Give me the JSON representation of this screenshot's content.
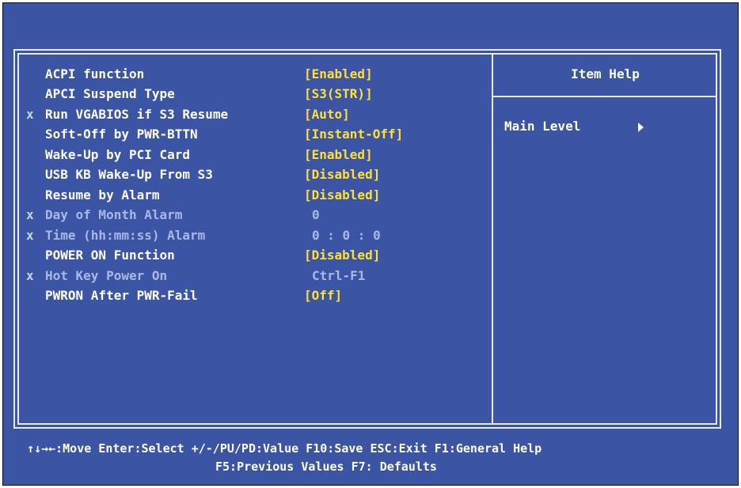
{
  "settings": [
    {
      "marker": "",
      "label": "ACPI function",
      "value": "[Enabled]",
      "enabled": true
    },
    {
      "marker": "",
      "label": "APCI Suspend Type",
      "value": "[S3(STR)]",
      "enabled": true
    },
    {
      "marker": "x",
      "label": "Run VGABIOS if S3 Resume",
      "value": "[Auto]",
      "enabled": true
    },
    {
      "marker": "",
      "label": "Soft-Off by PWR-BTTN",
      "value": "[Instant-Off]",
      "enabled": true
    },
    {
      "marker": "",
      "label": "Wake-Up by PCI Card",
      "value": "[Enabled]",
      "enabled": true
    },
    {
      "marker": "",
      "label": "USB KB Wake-Up From S3",
      "value": "[Disabled]",
      "enabled": true
    },
    {
      "marker": "",
      "label": "Resume by Alarm",
      "value": "[Disabled]",
      "enabled": true
    },
    {
      "marker": "x",
      "label": "Day of Month Alarm",
      "value": "0",
      "enabled": false
    },
    {
      "marker": "x",
      "label": "Time (hh:mm:ss) Alarm",
      "value": "0 : 0 : 0",
      "enabled": false
    },
    {
      "marker": "",
      "label": "POWER ON Function",
      "value": "[Disabled]",
      "enabled": true
    },
    {
      "marker": "x",
      "label": "Hot Key Power On",
      "value": "Ctrl-F1",
      "enabled": false
    },
    {
      "marker": "",
      "label": "PWRON After PWR-Fail",
      "value": "[Off]",
      "enabled": true
    }
  ],
  "help": {
    "title": "Item Help",
    "main_level": "Main Level",
    "arrow_icon": "right-triangle-icon"
  },
  "footer": {
    "line1": "↑↓→←:Move  Enter:Select  +/-/PU/PD:Value  F10:Save  ESC:Exit  F1:General Help",
    "line2": "F5:Previous Values     F7: Defaults"
  },
  "colors": {
    "background": "#3b54a4",
    "label": "#ffffff",
    "value": "#ffe033",
    "disabled": "#aab8e6",
    "frame": "#eaeaea"
  }
}
